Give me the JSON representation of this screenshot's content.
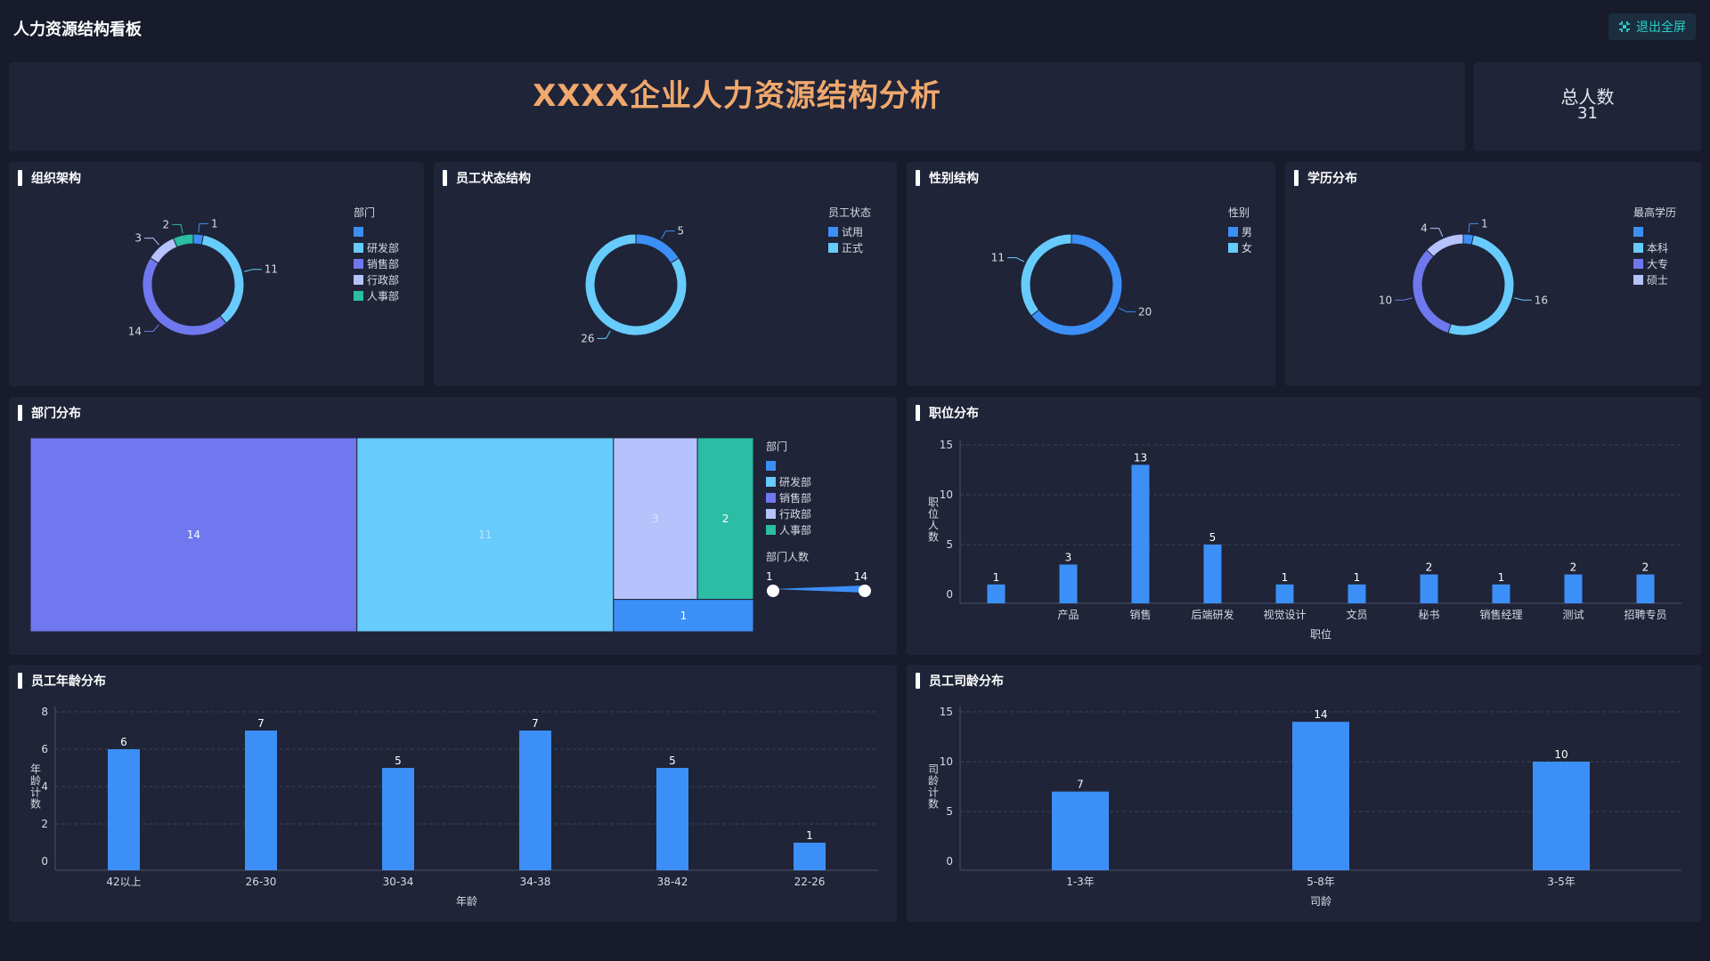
{
  "app": {
    "title": "人力资源结构看板",
    "exit_fullscreen": "退出全屏",
    "exit_icon": "fullscreen-exit-icon"
  },
  "banner": {
    "title": "XXXX企业人力资源结构分析"
  },
  "total": {
    "label": "总人数",
    "value": "31"
  },
  "panels": {
    "org": "组织架构",
    "status": "员工状态结构",
    "gender": "性别结构",
    "education": "学历分布",
    "dept": "部门分布",
    "position": "职位分布",
    "age": "员工年龄分布",
    "tenure": "员工司龄分布"
  },
  "colors": {
    "blue": "#3c8ff7",
    "cyan": "#67cbfb",
    "purple": "#6f78ee",
    "lavender": "#b6c2fb",
    "teal": "#2bbda5",
    "banner": "#f0a86d"
  },
  "chart_data": [
    {
      "id": "org",
      "type": "pie",
      "legend_title": "部门",
      "labels": [
        "",
        "研发部",
        "销售部",
        "行政部",
        "人事部"
      ],
      "values": [
        1,
        11,
        14,
        3,
        2
      ],
      "colors": [
        "#3c8ff7",
        "#67cbfb",
        "#6f78ee",
        "#b6c2fb",
        "#2bbda5"
      ]
    },
    {
      "id": "status",
      "type": "pie",
      "legend_title": "员工状态",
      "labels": [
        "试用",
        "正式"
      ],
      "values": [
        5,
        26
      ],
      "colors": [
        "#3c8ff7",
        "#67cbfb"
      ]
    },
    {
      "id": "gender",
      "type": "pie",
      "legend_title": "性别",
      "labels": [
        "男",
        "女"
      ],
      "values": [
        20,
        11
      ],
      "colors": [
        "#3c8ff7",
        "#67cbfb"
      ]
    },
    {
      "id": "education",
      "type": "pie",
      "legend_title": "最高学历",
      "labels": [
        "",
        "本科",
        "大专",
        "硕士"
      ],
      "values": [
        1,
        16,
        10,
        4
      ],
      "colors": [
        "#3c8ff7",
        "#67cbfb",
        "#6f78ee",
        "#b6c2fb"
      ]
    },
    {
      "id": "dept",
      "type": "treemap",
      "legend_title": "部门",
      "labels": [
        "",
        "研发部",
        "销售部",
        "行政部",
        "人事部"
      ],
      "values": [
        1,
        11,
        14,
        3,
        2
      ],
      "colors": [
        "#3c8ff7",
        "#67cbfb",
        "#6f78ee",
        "#b6c2fb",
        "#2bbda5"
      ],
      "range_title": "部门人数",
      "range": [
        1,
        14
      ]
    },
    {
      "id": "position",
      "type": "bar",
      "categories": [
        "",
        "产品",
        "销售",
        "后端研发",
        "视觉设计",
        "文员",
        "秘书",
        "销售经理",
        "测试",
        "招聘专员"
      ],
      "values": [
        1,
        3,
        13,
        5,
        1,
        1,
        2,
        1,
        2,
        2
      ],
      "xlabel": "职位",
      "ylabel": "职位人数",
      "ylim": [
        0,
        15
      ],
      "yticks": [
        0,
        5,
        10,
        15
      ]
    },
    {
      "id": "age",
      "type": "bar",
      "categories": [
        "42以上",
        "26-30",
        "30-34",
        "34-38",
        "38-42",
        "22-26"
      ],
      "values": [
        6,
        7,
        5,
        7,
        5,
        1
      ],
      "xlabel": "年龄",
      "ylabel": "年龄计数",
      "ylim": [
        0,
        8
      ],
      "yticks": [
        0,
        2,
        4,
        6,
        8
      ]
    },
    {
      "id": "tenure",
      "type": "bar",
      "categories": [
        "1-3年",
        "5-8年",
        "3-5年"
      ],
      "values": [
        7,
        14,
        10
      ],
      "xlabel": "司龄",
      "ylabel": "司龄计数",
      "ylim": [
        0,
        15
      ],
      "yticks": [
        0,
        5,
        10,
        15
      ]
    }
  ]
}
